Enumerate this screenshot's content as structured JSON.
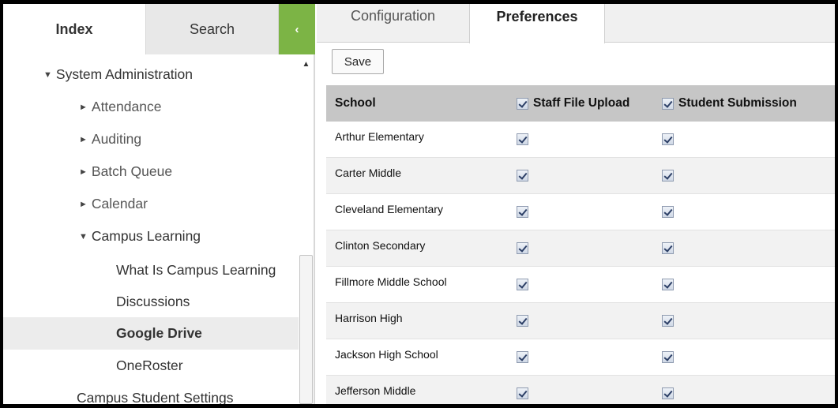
{
  "left_tabs": {
    "index": "Index",
    "search": "Search",
    "collapse": "‹"
  },
  "tree": [
    {
      "label": "System Administration",
      "caret": "▼"
    },
    {
      "label": "Attendance",
      "caret": "►"
    },
    {
      "label": "Auditing",
      "caret": "►"
    },
    {
      "label": "Batch Queue",
      "caret": "►"
    },
    {
      "label": "Calendar",
      "caret": "►"
    },
    {
      "label": "Campus Learning",
      "caret": "▼"
    },
    {
      "label": "What Is Campus Learning"
    },
    {
      "label": "Discussions"
    },
    {
      "label": "Google Drive",
      "selected": true
    },
    {
      "label": "OneRoster"
    },
    {
      "label": "Campus Student Settings"
    }
  ],
  "scroll": {
    "up": "▲"
  },
  "right_tabs": {
    "configuration": "Configuration",
    "preferences": "Preferences"
  },
  "toolbar": {
    "save_label": "Save"
  },
  "grid": {
    "headers": {
      "school": "School",
      "staff": "Staff File Upload",
      "student": "Student Submission"
    },
    "rows": [
      {
        "school": "Arthur Elementary",
        "staff": true,
        "student": true
      },
      {
        "school": "Carter Middle",
        "staff": true,
        "student": true
      },
      {
        "school": "Cleveland Elementary",
        "staff": true,
        "student": true
      },
      {
        "school": "Clinton Secondary",
        "staff": true,
        "student": true
      },
      {
        "school": "Fillmore Middle School",
        "staff": true,
        "student": true
      },
      {
        "school": "Harrison High",
        "staff": true,
        "student": true
      },
      {
        "school": "Jackson High School",
        "staff": true,
        "student": true
      },
      {
        "school": "Jefferson Middle",
        "staff": true,
        "student": true
      }
    ]
  },
  "colors": {
    "accent_green": "#7cb445",
    "header_gray": "#c6c6c6",
    "selected_row": "#ececec"
  }
}
